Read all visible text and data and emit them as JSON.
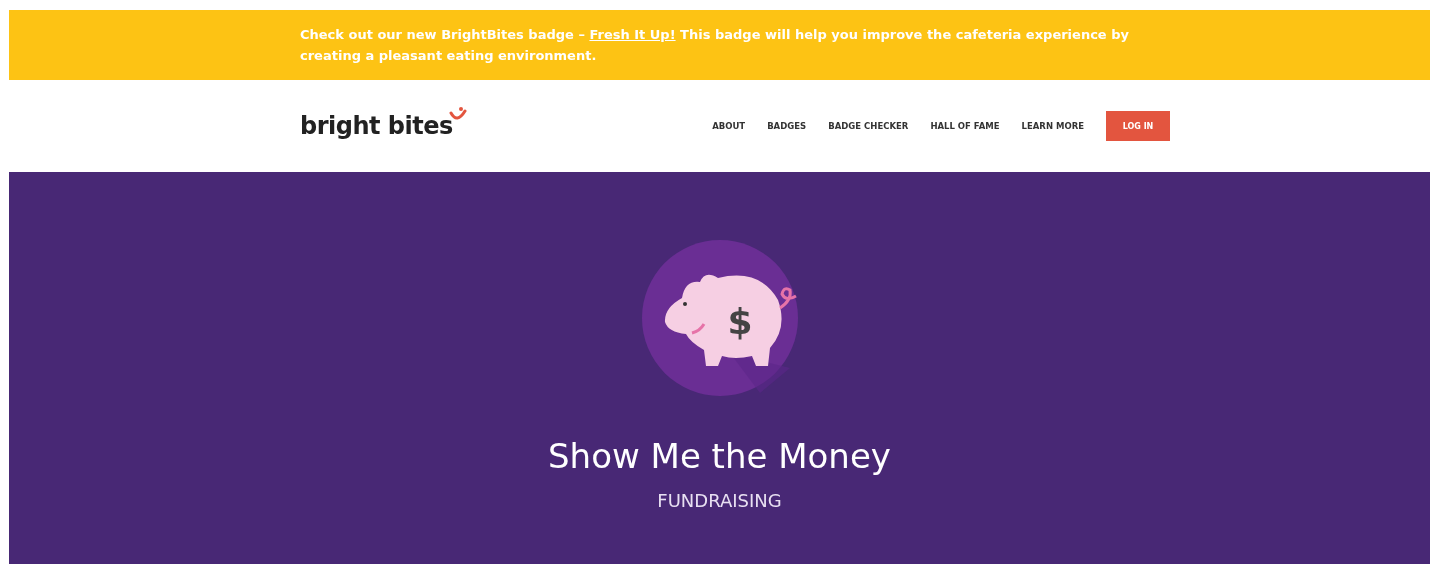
{
  "banner": {
    "before": "Check out our new BrightBites badge – ",
    "link": "Fresh It Up!",
    "after": " This badge will help you improve the cafeteria experience by creating a pleasant eating environment."
  },
  "header": {
    "logo": "bright bites",
    "nav": [
      "ABOUT",
      "BADGES",
      "BADGE CHECKER",
      "HALL OF FAME",
      "LEARN MORE"
    ],
    "login": "LOG IN"
  },
  "hero": {
    "badge_symbol": "$",
    "title": "Show Me the Money",
    "category": "FUNDRAISING"
  }
}
